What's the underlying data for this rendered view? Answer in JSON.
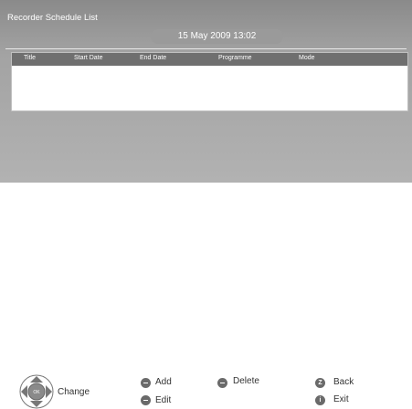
{
  "window": {
    "title": "Recorder Schedule List"
  },
  "header": {
    "datetime": "15 May 2009 13:02"
  },
  "table": {
    "columns": [
      "Title",
      "Start Date",
      "End Date",
      "Programme",
      "Mode"
    ],
    "rows": []
  },
  "footer": {
    "change_label": "Change",
    "ok_label": "OK",
    "add_label": "Add",
    "edit_label": "Edit",
    "delete_label": "Delete",
    "back_key": "Z",
    "back_label": "Back",
    "exit_key": "i",
    "exit_label": "Exit"
  },
  "icons": {
    "dpad": "dpad-ok-icon",
    "add": "minus-button-icon",
    "edit": "minus-button-icon",
    "delete": "minus-button-icon",
    "back": "z-button-icon",
    "exit": "info-button-icon"
  }
}
